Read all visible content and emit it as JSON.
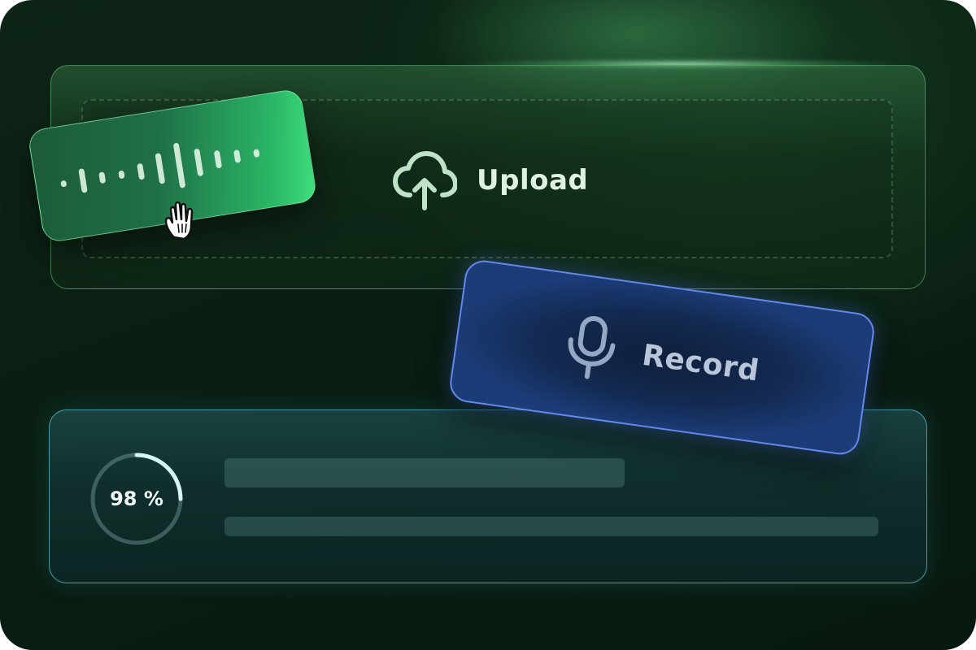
{
  "upload": {
    "label": "Upload",
    "icon": "cloud-upload-icon"
  },
  "audio_clip": {
    "icon": "waveform-icon",
    "cursor_icon": "hand-grab-icon"
  },
  "record": {
    "label": "Record",
    "icon": "microphone-icon"
  },
  "progress": {
    "percent_label": "98 %",
    "value": 0.98
  },
  "colors": {
    "background": "#0a1f13",
    "upload_accent": "#6ec882",
    "record_accent": "#6e96ff",
    "progress_accent": "#5abed2"
  }
}
